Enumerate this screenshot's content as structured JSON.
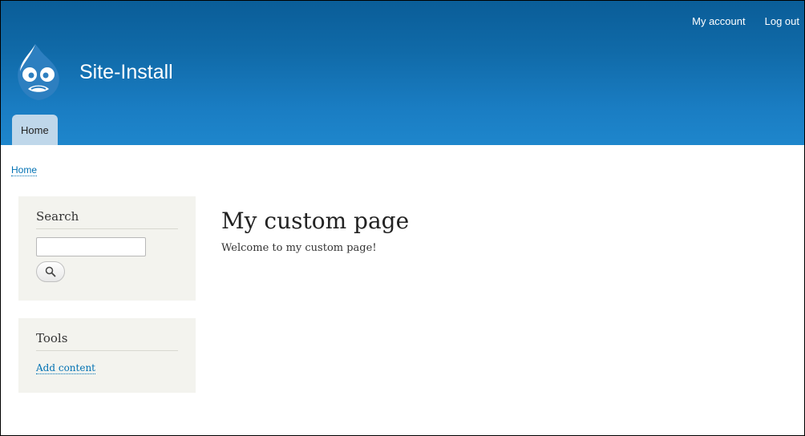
{
  "header": {
    "site_name": "Site-Install",
    "secondary_nav": [
      "My account",
      "Log out"
    ],
    "tabs": [
      "Home"
    ]
  },
  "breadcrumb": {
    "home": "Home"
  },
  "sidebar": {
    "search": {
      "title": "Search",
      "input_value": "",
      "button_icon": "search-icon"
    },
    "tools": {
      "title": "Tools",
      "link": "Add content"
    }
  },
  "main": {
    "title": "My custom page",
    "body": "Welcome to my custom page!"
  },
  "colors": {
    "header_top": "#0a5d98",
    "header_bottom": "#1e86cc",
    "tab_bg": "#bfd7ea",
    "link": "#0071b3",
    "sidebar_bg": "#f3f3ee"
  }
}
